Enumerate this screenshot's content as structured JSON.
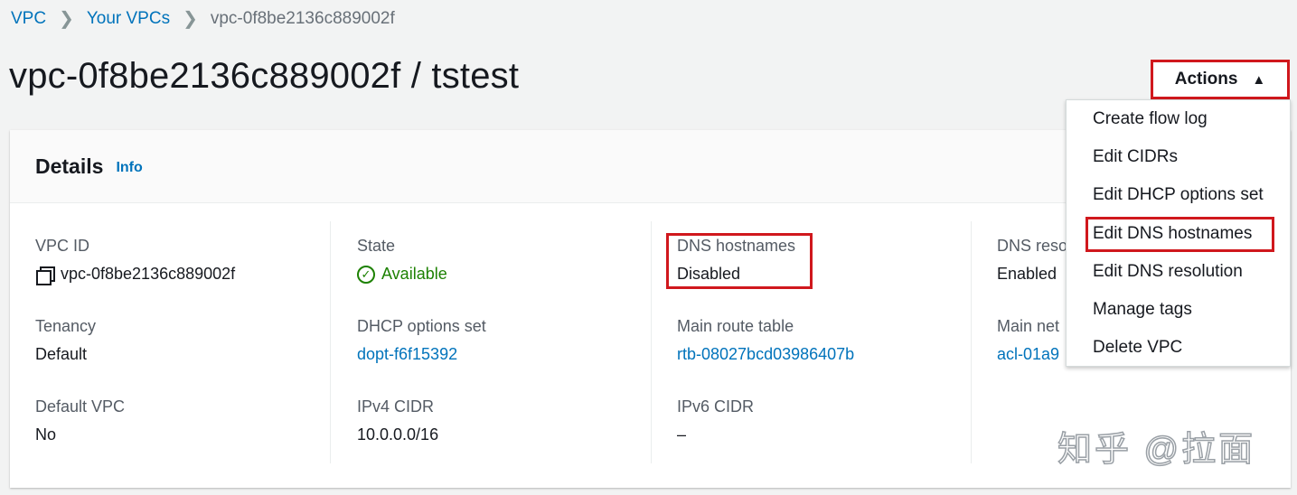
{
  "breadcrumb": {
    "items": [
      "VPC",
      "Your VPCs"
    ],
    "current": "vpc-0f8be2136c889002f"
  },
  "page": {
    "title": "vpc-0f8be2136c889002f / tstest"
  },
  "actions": {
    "label": "Actions",
    "caret": "▲",
    "menu": [
      "Create flow log",
      "Edit CIDRs",
      "Edit DHCP options set",
      "Edit DNS hostnames",
      "Edit DNS resolution",
      "Manage tags",
      "Delete VPC"
    ]
  },
  "details": {
    "title": "Details",
    "info": "Info",
    "col1": {
      "vpc_id_label": "VPC ID",
      "vpc_id_value": "vpc-0f8be2136c889002f",
      "tenancy_label": "Tenancy",
      "tenancy_value": "Default",
      "default_vpc_label": "Default VPC",
      "default_vpc_value": "No"
    },
    "col2": {
      "state_label": "State",
      "state_value": "Available",
      "dhcp_label": "DHCP options set",
      "dhcp_value": "dopt-f6f15392",
      "ipv4_label": "IPv4 CIDR",
      "ipv4_value": "10.0.0.0/16"
    },
    "col3": {
      "dns_hostnames_label": "DNS hostnames",
      "dns_hostnames_value": "Disabled",
      "route_table_label": "Main route table",
      "route_table_value": "rtb-08027bcd03986407b",
      "ipv6_label": "IPv6 CIDR",
      "ipv6_value": "–"
    },
    "col4": {
      "dns_resolution_label": "DNS reso",
      "dns_resolution_value": "Enabled",
      "main_acl_label": "Main net",
      "main_acl_value": "acl-01a9"
    }
  },
  "watermark": "知乎 @拉面",
  "colors": {
    "link": "#0073bb",
    "success": "#1d8102",
    "highlight": "#d0181d",
    "background": "#f2f3f3"
  }
}
